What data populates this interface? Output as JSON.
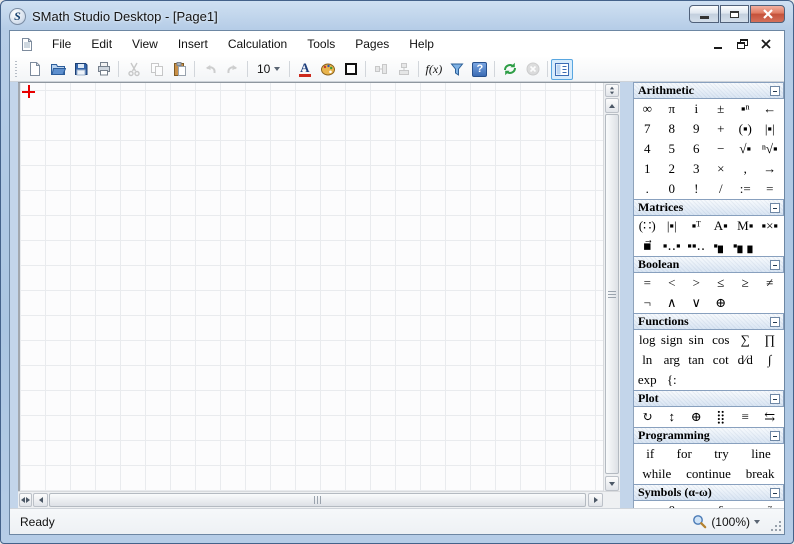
{
  "window": {
    "title": "SMath Studio Desktop - [Page1]",
    "logo": "S"
  },
  "menu": {
    "items": [
      "File",
      "Edit",
      "View",
      "Insert",
      "Calculation",
      "Tools",
      "Pages",
      "Help"
    ]
  },
  "toolbar": {
    "font_size": "10",
    "font_button_label": "A",
    "fx_label": "f(x)",
    "reference_glyph": "?"
  },
  "statusbar": {
    "status": "Ready",
    "zoom": "(100%)"
  },
  "colors": {
    "frame_blue": "#b6cde7",
    "close_button_red": "#c4513a",
    "cursor_red": "#e80000",
    "active_tool_border": "#58a6e0",
    "panel_header_border": "#88a0be",
    "refresh_green": "#2e9e46"
  },
  "sidebar": {
    "panels": [
      {
        "title": "Arithmetic",
        "rows": [
          [
            "∞",
            "π",
            "i",
            "±",
            "▪ⁿ",
            "←"
          ],
          [
            "7",
            "8",
            "9",
            "+",
            "(▪)",
            "|▪|"
          ],
          [
            "4",
            "5",
            "6",
            "−",
            "√▪",
            "ⁿ√▪"
          ],
          [
            "1",
            "2",
            "3",
            "×",
            ",",
            "→"
          ],
          [
            ".",
            "0",
            "!",
            "/",
            ":=",
            "="
          ]
        ]
      },
      {
        "title": "Matrices",
        "rows": [
          [
            "(∷)",
            "|▪|",
            "▪ᵀ",
            "A▪",
            "M▪",
            "▪×▪"
          ],
          [
            "▪⃗",
            "▪‥▪",
            "▪▪‥",
            "▪▖",
            "▪▖▖"
          ]
        ]
      },
      {
        "title": "Boolean",
        "rows": [
          [
            "=",
            "<",
            ">",
            "≤",
            "≥",
            "≠"
          ],
          [
            "¬",
            "∧",
            "∨",
            "⊕"
          ]
        ]
      },
      {
        "title": "Functions",
        "rows": [
          [
            "log",
            "sign",
            "sin",
            "cos",
            "∑",
            "∏"
          ],
          [
            "ln",
            "arg",
            "tan",
            "cot",
            "d∕d",
            "∫"
          ],
          [
            "exp",
            "{:"
          ]
        ]
      },
      {
        "title": "Plot",
        "rows": [
          [
            "↻",
            "↕",
            "⊕",
            "⣿",
            "≡",
            "⇆"
          ]
        ]
      },
      {
        "title": "Programming",
        "rows": [
          {
            "spread": true,
            "items": [
              "if",
              "for",
              "try",
              "line"
            ]
          },
          {
            "spread": true,
            "items": [
              "while",
              "continue",
              "break"
            ]
          }
        ]
      },
      {
        "title": "Symbols (α-ω)",
        "rows": [
          [
            "α",
            "β",
            "γ",
            "δ",
            "ε",
            "ζ"
          ]
        ]
      }
    ]
  }
}
